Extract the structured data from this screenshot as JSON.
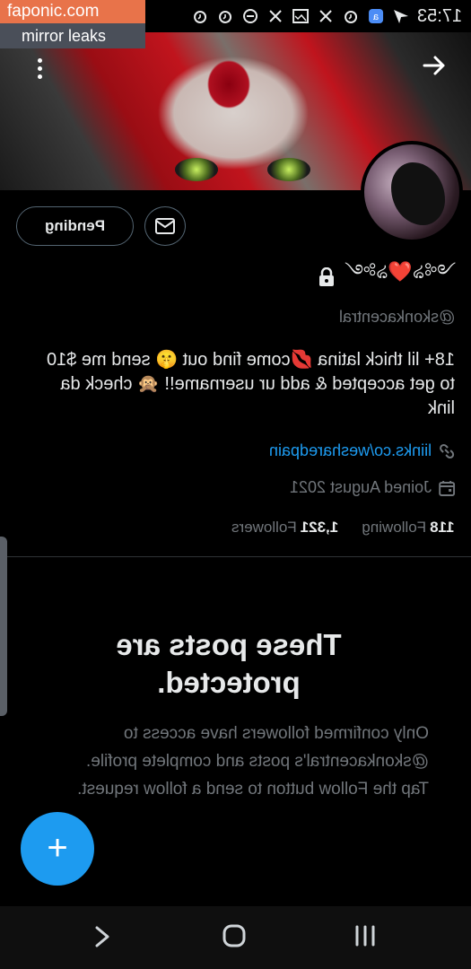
{
  "watermark": {
    "site": "faponic.com",
    "tagline": "mirror leaks"
  },
  "status_bar": {
    "time": "17:53",
    "icons": [
      "alarm-icon",
      "alarm-icon",
      "do-not-disturb-icon",
      "x-icon",
      "gallery-icon",
      "x-icon",
      "alarm-icon",
      "app-icon",
      "send-icon"
    ]
  },
  "profile": {
    "display_name": "༺ঌ❤️ঌ༻",
    "handle": "@skonkacentral",
    "bio": "18+ lil thick latina 💋come find out 🤫 send me $10 to get accepted & add ur username!! 🙊 check da link",
    "link": "liinks.co/wesharedpain",
    "joined": "Joined August 2021",
    "following_count": "118",
    "following_label": "Following",
    "followers_count": "1,321",
    "followers_label": "Followers"
  },
  "actions": {
    "pending_label": "Pending"
  },
  "protected": {
    "title": "These posts are protected.",
    "description": "Only confirmed followers have access to @skonkacentral's posts and complete profile. Tap the Follow button to send a follow request."
  },
  "fab": {
    "label": "+"
  },
  "colors": {
    "accent": "#1d9bf0",
    "background": "#000000",
    "muted": "#71767b",
    "watermark_orange": "#e8734a"
  }
}
